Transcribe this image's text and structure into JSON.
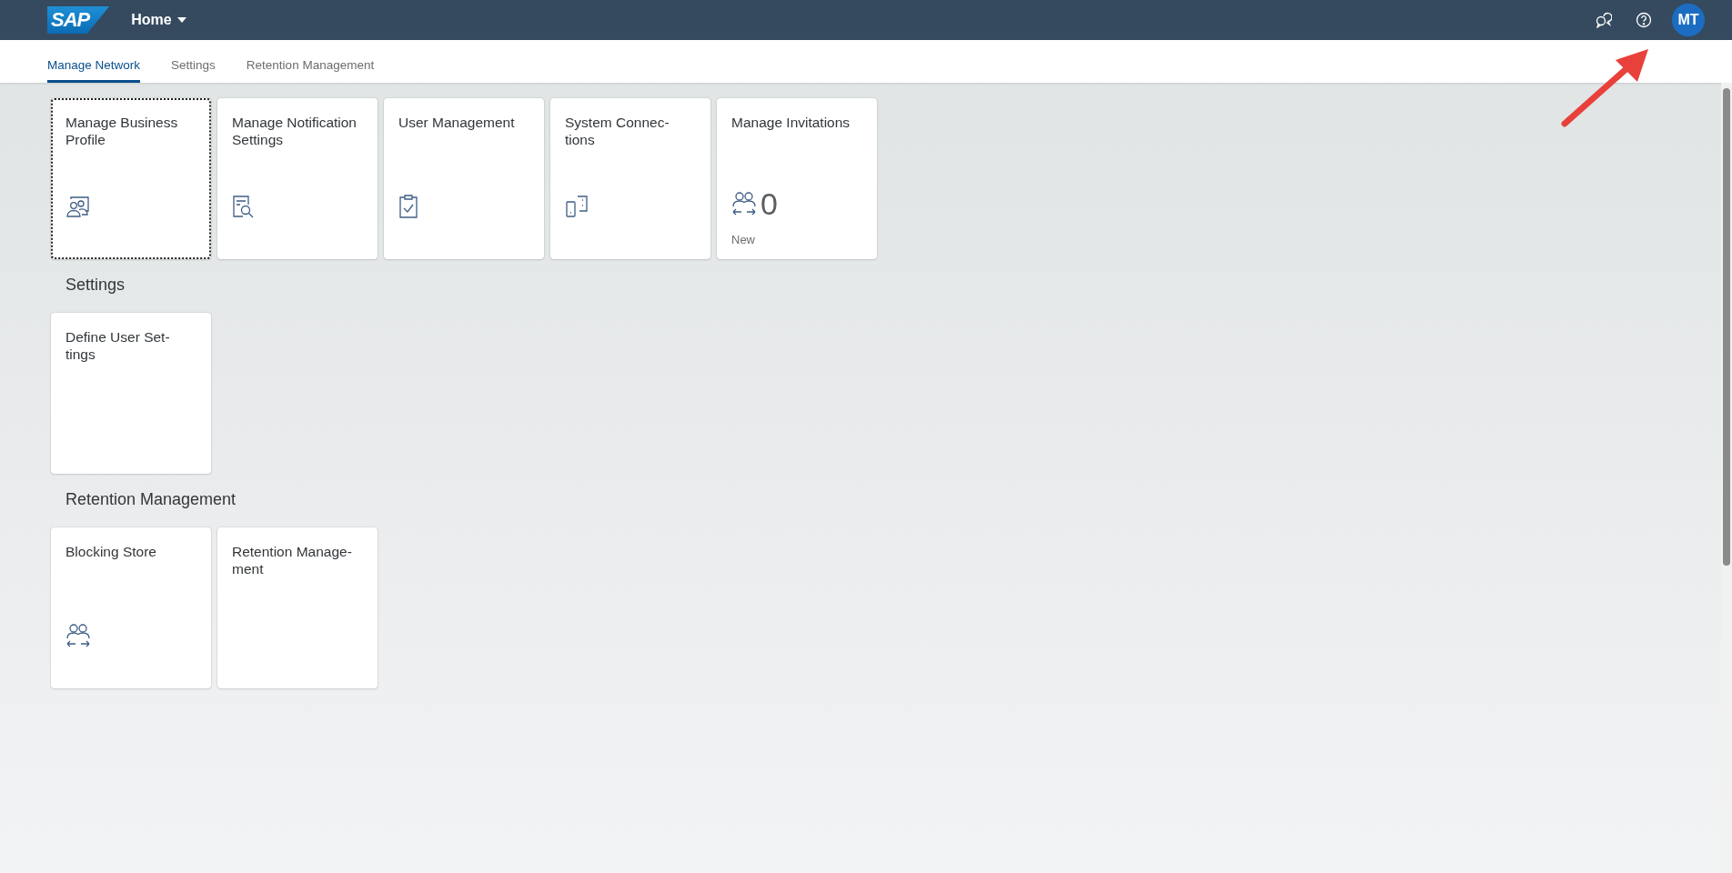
{
  "shell_bar": {
    "logo": "SAP",
    "title": "Home",
    "avatar": "MT"
  },
  "tabs": [
    {
      "label": "Manage Network",
      "selected": true
    },
    {
      "label": "Settings",
      "selected": false
    },
    {
      "label": "Retention Management",
      "selected": false
    }
  ],
  "sections": [
    {
      "tiles": [
        {
          "title_lines": [
            "Manage Business",
            "Profile"
          ],
          "kind": "profile",
          "focused": true
        },
        {
          "title_lines": [
            "Manage Notification",
            "Settings"
          ],
          "kind": "notification",
          "focused": false
        },
        {
          "title_lines": [
            "User Management"
          ],
          "kind": "clipboard",
          "focused": false
        },
        {
          "title_lines": [
            "System Connec-",
            "tions"
          ],
          "kind": "devices",
          "focused": false
        },
        {
          "title_lines": [
            "Manage Invitations"
          ],
          "kind": "exchange",
          "focused": false,
          "count": "0",
          "footer": "New"
        }
      ]
    },
    {
      "heading": "Settings",
      "tiles": [
        {
          "title_lines": [
            "Define User Set-",
            "tings"
          ],
          "kind": "plain",
          "focused": false
        }
      ]
    },
    {
      "heading": "Retention Management",
      "tiles": [
        {
          "title_lines": [
            "Blocking Store"
          ],
          "kind": "exchange",
          "focused": false
        },
        {
          "title_lines": [
            "Retention Manage-",
            "ment"
          ],
          "kind": "plain",
          "focused": false
        }
      ]
    }
  ]
}
